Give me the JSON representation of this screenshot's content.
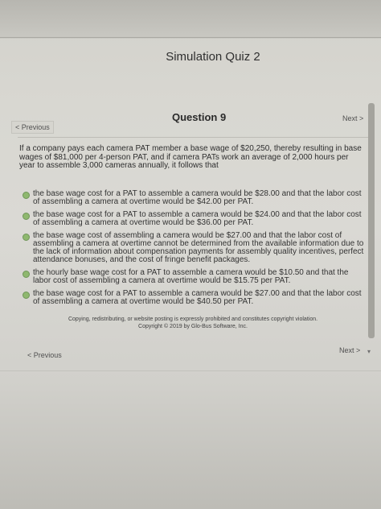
{
  "header": {
    "title": "Simulation Quiz 2"
  },
  "nav": {
    "previous_label": "< Previous",
    "next_label": "Next >"
  },
  "question": {
    "title": "Question 9",
    "prompt": "If a company pays each camera PAT member a base wage of $20,250, thereby resulting in base wages of $81,000 per 4-person PAT, and if camera PATs work an average of 2,000 hours per year to assemble 3,000 cameras annually, it follows that",
    "options": [
      "the base wage cost for a PAT to assemble a camera would be $28.00 and that the labor cost of assembling a camera at overtime would be $42.00 per PAT.",
      "the base wage cost for a PAT to assemble a camera would be $24.00 and that the labor cost of assembling a camera at overtime would be $36.00 per PAT.",
      "the base wage cost of assembling a camera would be $27.00 and that the labor cost of assembling a camera at overtime cannot be determined from the available information due to the lack of information about compensation payments for assembly quality incentives, perfect attendance bonuses, and the cost of fringe benefit packages.",
      "the hourly base wage cost for a PAT to assemble a camera would be $10.50 and that the labor cost of assembling a camera at overtime would be $15.75 per PAT.",
      "the base wage cost for a PAT to assemble a camera would be $27.00 and that the labor cost of assembling a camera at overtime would be $40.50 per PAT."
    ]
  },
  "footer": {
    "copyright_line1": "Copying, redistributing, or website posting is expressly prohibited and constitutes copyright violation.",
    "copyright_line2": "Copyright © 2019 by Glo-Bus Software, Inc."
  },
  "icons": {
    "radio": "radio-button-icon",
    "scroll_down": "chevron-down-icon"
  },
  "colors": {
    "radio_fill": "#8fb86f",
    "background": "#d8d7d1"
  }
}
